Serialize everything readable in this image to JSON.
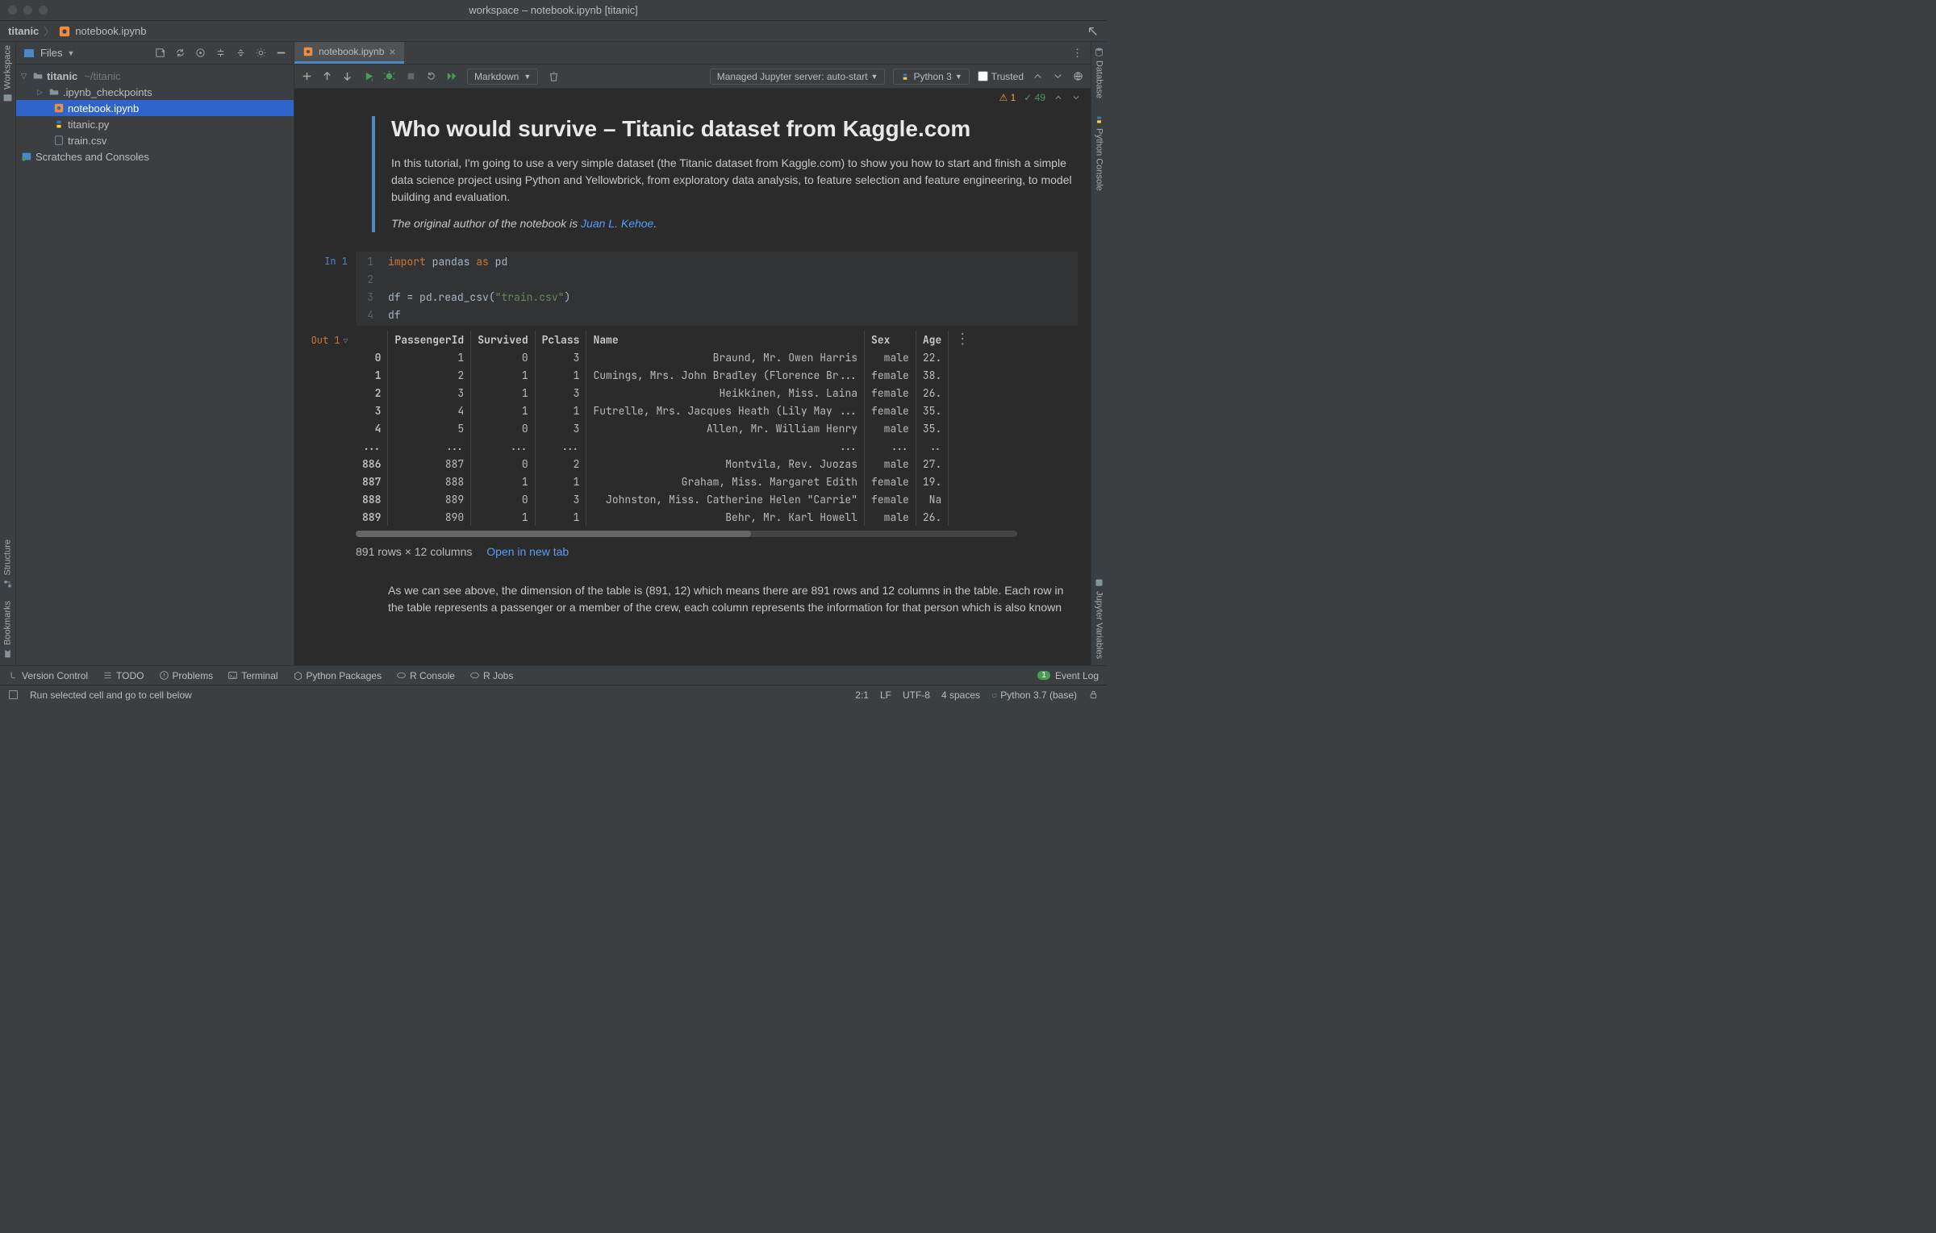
{
  "titlebar": {
    "title": "workspace – notebook.ipynb [titanic]"
  },
  "breadcrumbs": {
    "project": "titanic",
    "file": "notebook.ipynb"
  },
  "left_rail": {
    "top": "Workspace",
    "bottom": [
      "Structure",
      "Bookmarks"
    ]
  },
  "right_rail": [
    "Database",
    "Python Console",
    "Jupyter Variables"
  ],
  "sidebar": {
    "title": "Files",
    "root": {
      "name": "titanic",
      "path": "~/titanic"
    },
    "items": [
      {
        "name": ".ipynb_checkpoints",
        "type": "folder"
      },
      {
        "name": "notebook.ipynb",
        "type": "notebook",
        "selected": true
      },
      {
        "name": "titanic.py",
        "type": "python"
      },
      {
        "name": "train.csv",
        "type": "file"
      }
    ],
    "scratches": "Scratches and Consoles"
  },
  "tab": {
    "label": "notebook.ipynb"
  },
  "toolbar": {
    "cell_type": "Markdown",
    "server": "Managed Jupyter server: auto-start",
    "interpreter": "Python 3",
    "trusted_label": "Trusted"
  },
  "notices": {
    "warn_count": "1",
    "ok_count": "49"
  },
  "md1": {
    "title": "Who would survive – Titanic dataset from Kaggle.com",
    "p1": "In this tutorial, I'm going to use a very simple dataset (the Titanic dataset from Kaggle.com) to show you how to start and finish a simple data science project using Python and Yellowbrick, from exploratory data analysis, to feature selection and feature engineering, to model building and evaluation.",
    "p2_prefix": "The original author of the notebook is ",
    "p2_link": "Juan L. Kehoe",
    "p2_suffix": "."
  },
  "code1": {
    "prompt": "In 1",
    "lines": {
      "l1": "1",
      "l2": "2",
      "l3": "3",
      "l4": "4"
    },
    "t": {
      "import": "import",
      "pandas": "pandas",
      "as": "as",
      "pd": "pd",
      "df": "df",
      "eq": " = ",
      "readcsv": "pd.read_csv(",
      "str": "\"train.csv\"",
      "close": ")"
    }
  },
  "out1": {
    "prompt": "Out 1",
    "columns": [
      "",
      "PassengerId",
      "Survived",
      "Pclass",
      "Name",
      "Sex",
      "Age"
    ],
    "rows": [
      [
        "0",
        "1",
        "0",
        "3",
        "Braund, Mr. Owen Harris",
        "male",
        "22."
      ],
      [
        "1",
        "2",
        "1",
        "1",
        "Cumings, Mrs. John Bradley (Florence Br...",
        "female",
        "38."
      ],
      [
        "2",
        "3",
        "1",
        "3",
        "Heikkinen, Miss. Laina",
        "female",
        "26."
      ],
      [
        "3",
        "4",
        "1",
        "1",
        "Futrelle, Mrs. Jacques Heath (Lily May ...",
        "female",
        "35."
      ],
      [
        "4",
        "5",
        "0",
        "3",
        "Allen, Mr. William Henry",
        "male",
        "35."
      ],
      [
        "...",
        "...",
        "...",
        "...",
        "...",
        "...",
        ".."
      ],
      [
        "886",
        "887",
        "0",
        "2",
        "Montvila, Rev. Juozas",
        "male",
        "27."
      ],
      [
        "887",
        "888",
        "1",
        "1",
        "Graham, Miss. Margaret Edith",
        "female",
        "19."
      ],
      [
        "888",
        "889",
        "0",
        "3",
        "Johnston, Miss. Catherine Helen \"Carrie\"",
        "female",
        "Na"
      ],
      [
        "889",
        "890",
        "1",
        "1",
        "Behr, Mr. Karl Howell",
        "male",
        "26."
      ]
    ],
    "summary": "891 rows × 12 columns",
    "open_label": "Open in new tab"
  },
  "md2": "As we can see above, the dimension of the table is (891, 12) which means there are 891 rows and 12 columns in the table. Each row in the table represents a passenger or a member of the crew, each column represents the information for that person which is also known",
  "bottom_tools": {
    "items": [
      "Version Control",
      "TODO",
      "Problems",
      "Terminal",
      "Python Packages",
      "R Console",
      "R Jobs"
    ],
    "eventlog": "Event Log",
    "eventlog_count": "1"
  },
  "statusbar": {
    "hint": "Run selected cell and go to cell below",
    "pos": "2:1",
    "eol": "LF",
    "enc": "UTF-8",
    "indent": "4 spaces",
    "interp": "Python 3.7 (base)"
  }
}
